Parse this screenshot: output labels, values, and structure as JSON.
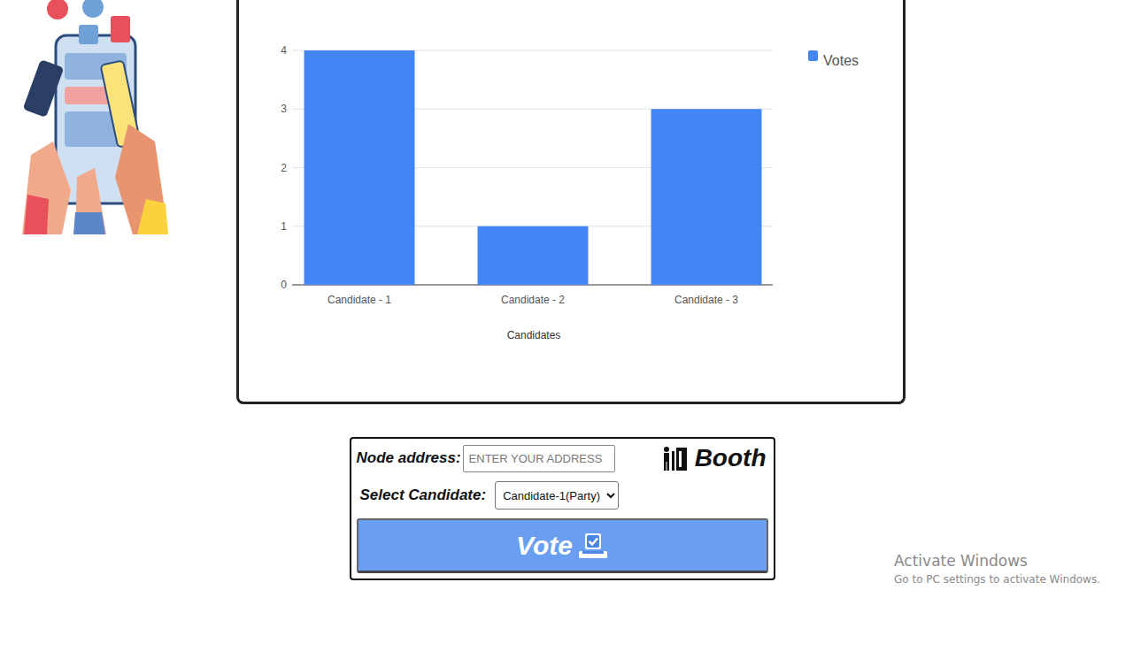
{
  "chart": {
    "series": [
      {
        "name": "Votes",
        "values": [
          4,
          1,
          3
        ]
      }
    ],
    "categories": [
      "Candidate - 1",
      "Candidate - 2",
      "Candidate - 3"
    ],
    "y_ticks": [
      "0",
      "1",
      "2",
      "3",
      "4"
    ],
    "x_title": "Candidates"
  },
  "booth": {
    "title": "Booth",
    "node_label": "Node address:",
    "node_placeholder": "ENTER YOUR ADDRESS",
    "select_label": "Select Candidate:",
    "select_value": "Candidate-1(Party)",
    "button": "Vote"
  },
  "watermark": {
    "title": "Activate Windows",
    "subtitle": "Go to PC settings to activate Windows."
  }
}
